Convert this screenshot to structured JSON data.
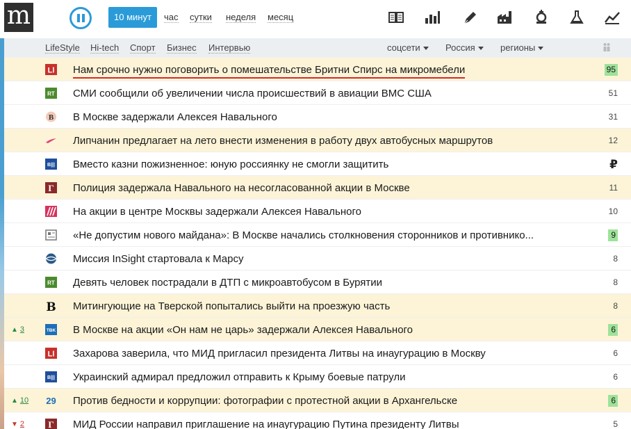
{
  "logo": "m",
  "periods": [
    {
      "label": "10 минут",
      "active": true
    },
    {
      "label": "час",
      "active": false
    },
    {
      "label": "сутки",
      "active": false
    },
    {
      "label": "неделя",
      "active": false
    },
    {
      "label": "месяц",
      "active": false
    }
  ],
  "toolbar_icons": [
    "columns-icon",
    "bar-chart-icon",
    "pen-icon",
    "factory-icon",
    "chess-king-icon",
    "flask-icon",
    "trend-line-icon"
  ],
  "categories": [
    "LifeStyle",
    "Hi-tech",
    "Спорт",
    "Бизнес",
    "Интервью"
  ],
  "dropdowns": [
    "соцсети",
    "Россия",
    "регионы"
  ],
  "accent": "#2a9bd8",
  "highlight": "#fdf4d8",
  "news": [
    {
      "title": "Нам срочно нужно поговорить о помешательстве Бритни Спирс на микромебели",
      "count": "95",
      "green": true,
      "hl": true,
      "src": "l1-icon",
      "trend": null
    },
    {
      "title": "СМИ сообщили об увеличении числа происшествий в авиации ВМС США",
      "count": "51",
      "green": false,
      "hl": false,
      "src": "rt-icon",
      "trend": null
    },
    {
      "title": "В Москве задержали Алексея Навального",
      "count": "31",
      "green": false,
      "hl": false,
      "src": "b-circle-icon",
      "trend": null
    },
    {
      "title": "Липчанин предлагает на лето внести изменения в работу двух автобусных маршрутов",
      "count": "12",
      "green": false,
      "hl": true,
      "src": "bird-icon",
      "trend": null
    },
    {
      "title": "Вместо казни пожизненное: юную россиянку не смогли защитить",
      "count": "₽",
      "green": false,
      "hl": false,
      "src": "vesti-icon",
      "trend": null,
      "rub": true
    },
    {
      "title": "Полиция задержала Навального на несогласованной акции в Москве",
      "count": "11",
      "green": false,
      "hl": true,
      "src": "g-icon",
      "trend": null
    },
    {
      "title": "На акции в центре Москвы задержали Алексея Навального",
      "count": "10",
      "green": false,
      "hl": false,
      "src": "stripes-icon",
      "trend": null
    },
    {
      "title": "«Не допустим нового майдана»: В Москве начались столкновения сторонников и противнико...",
      "count": "9",
      "green": true,
      "hl": false,
      "src": "gazeta-icon",
      "trend": null
    },
    {
      "title": "Миссия InSight стартовала к Марсу",
      "count": "8",
      "green": false,
      "hl": false,
      "src": "globe-icon",
      "trend": null
    },
    {
      "title": "Девять человек пострадали в ДТП с микроавтобусом в Бурятии",
      "count": "8",
      "green": false,
      "hl": false,
      "src": "rt-icon",
      "trend": null
    },
    {
      "title": "Митингующие на Тверской попытались выйти на проезжую часть",
      "count": "8",
      "green": false,
      "hl": true,
      "src": "b-bold-icon",
      "trend": null
    },
    {
      "title": "В Москве на акции «Он нам не царь» задержали Алексея Навального",
      "count": "6",
      "green": true,
      "hl": true,
      "src": "tass-icon",
      "trend": {
        "dir": "up",
        "n": "3"
      }
    },
    {
      "title": "Захарова заверила, что МИД пригласил президента Литвы на инаугурацию в Москву",
      "count": "6",
      "green": false,
      "hl": false,
      "src": "l1-icon",
      "trend": null
    },
    {
      "title": "Украинский адмирал предложил отправить к Крыму боевые патрули",
      "count": "6",
      "green": false,
      "hl": false,
      "src": "vesti-icon",
      "trend": null
    },
    {
      "title": "Против бедности и коррупции: фотографии с протестной акции в Архангельске",
      "count": "6",
      "green": true,
      "hl": true,
      "src": "29-icon",
      "trend": {
        "dir": "up",
        "n": "10"
      }
    },
    {
      "title": "МИД России направил приглашение на инаугурацию Путина президенту Литвы",
      "count": "5",
      "green": false,
      "hl": false,
      "src": "g-icon",
      "trend": {
        "dir": "down",
        "n": "2"
      }
    }
  ]
}
